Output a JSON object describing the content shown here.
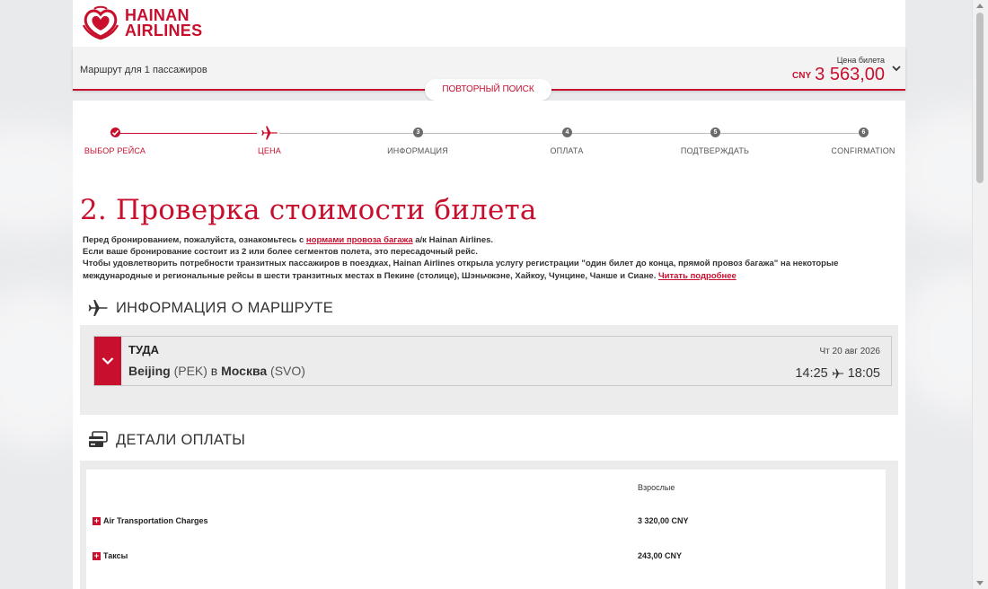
{
  "brand": {
    "line1": "HAINAN",
    "line2": "AIRLINES"
  },
  "route_bar": {
    "text": "Маршрут для 1 пассажиров",
    "price_label": "Цена билета",
    "currency": "CNY",
    "amount": "3 563,00",
    "research_label": "ПОВТОРНЫЙ ПОИСК"
  },
  "steps": [
    {
      "label": "ВЫБОР РЕЙСА",
      "state": "done"
    },
    {
      "label": "ЦЕНА",
      "state": "active"
    },
    {
      "num": "3",
      "label": "ИНФОРМАЦИЯ",
      "state": "todo"
    },
    {
      "num": "4",
      "label": "ОПЛАТА",
      "state": "todo"
    },
    {
      "num": "5",
      "label": "ПОДТВЕРЖДАТЬ",
      "state": "todo"
    },
    {
      "num": "6",
      "label": "CONFIRMATION",
      "state": "todo"
    }
  ],
  "main": {
    "title": "2. Проверка стоимости билета",
    "intro": {
      "p1_before": "Перед бронированием, пожалуйста, ознакомьтесь с ",
      "p1_link": "нормами провоза багажа",
      "p1_after": " а/к Hainan Airlines.",
      "p2": "Если ваше бронирование состоит из 2 или более сегментов полета, это пересадочный рейс.",
      "p3": "Чтобы удовлетворить потребности транзитных пассажиров в поездках, Hainan Airlines открыла услугу регистрации \"один билет до конца, прямой провоз багажа\" на некоторые международные и региональные рейсы в шести транзитных местах в Пекине (столице), Шэньчжэне, Хайкоу, Чунцине, Чанше и Сиане. ",
      "p3_link": "Читать подробнее"
    },
    "route_info_heading": "ИНФОРМАЦИЯ О МАРШРУТЕ",
    "flight": {
      "direction": "ТУДА",
      "from_city": "Beijing",
      "from_code": "(PEK)",
      "connector": " в ",
      "to_city": "Москва",
      "to_code": "(SVO)",
      "date": "Чт 20 авг 2026",
      "depart": "14:25",
      "arrive": "18:05"
    },
    "payment_heading": "ДЕТАЛИ ОПЛАТЫ",
    "payment": {
      "column": "Взрослые",
      "rows": [
        {
          "label": "Air Transportation Charges",
          "value": "3 320,00 CNY"
        },
        {
          "label": "Таксы",
          "value": "243,00 CNY"
        }
      ]
    }
  },
  "colors": {
    "accent": "#c8102e",
    "page_bg": "#e9eaec",
    "panel_bg": "#ececec"
  }
}
